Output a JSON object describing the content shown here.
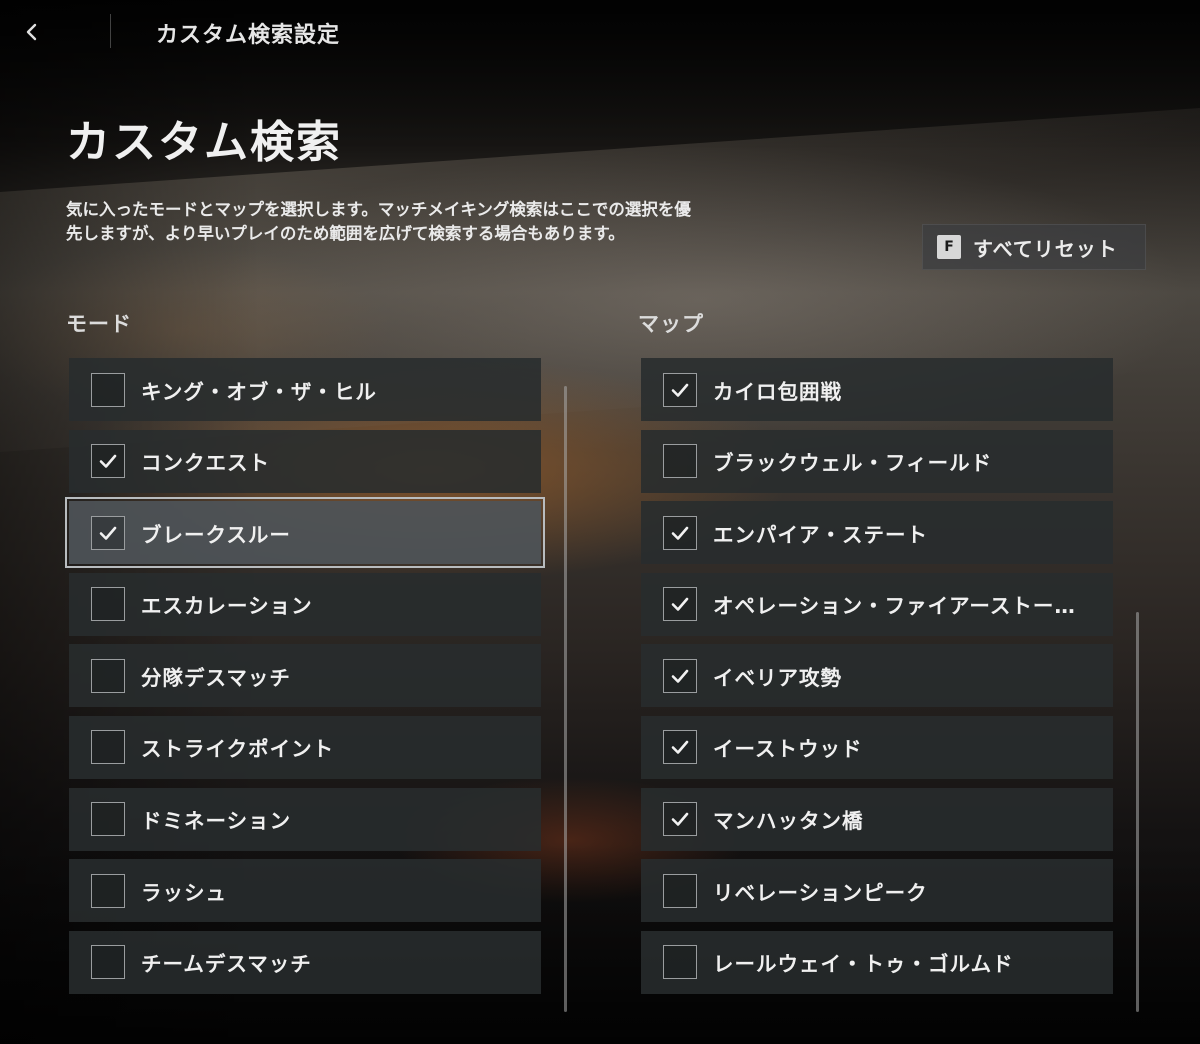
{
  "header": {
    "title": "カスタム検索設定",
    "back_icon": "chevron-left-icon"
  },
  "page": {
    "title": "カスタム検索",
    "description_line1": "気に入ったモードとマップを選択します。マッチメイキング検索はここでの選択を優",
    "description_line2": "先しますが、より早いプレイのため範囲を広げて検索する場合もあります。"
  },
  "reset": {
    "key": "F",
    "label": "すべてリセット"
  },
  "modes": {
    "header": "モード",
    "items": [
      {
        "label": "キング・オブ・ザ・ヒル",
        "checked": false,
        "selected": false
      },
      {
        "label": "コンクエスト",
        "checked": true,
        "selected": false
      },
      {
        "label": "ブレークスルー",
        "checked": true,
        "selected": true
      },
      {
        "label": "エスカレーション",
        "checked": false,
        "selected": false
      },
      {
        "label": "分隊デスマッチ",
        "checked": false,
        "selected": false
      },
      {
        "label": "ストライクポイント",
        "checked": false,
        "selected": false
      },
      {
        "label": "ドミネーション",
        "checked": false,
        "selected": false
      },
      {
        "label": "ラッシュ",
        "checked": false,
        "selected": false
      },
      {
        "label": "チームデスマッチ",
        "checked": false,
        "selected": false
      }
    ]
  },
  "maps": {
    "header": "マップ",
    "items": [
      {
        "label": "カイロ包囲戦",
        "checked": true,
        "selected": false
      },
      {
        "label": "ブラックウェル・フィールド",
        "checked": false,
        "selected": false
      },
      {
        "label": "エンパイア・ステート",
        "checked": true,
        "selected": false
      },
      {
        "label": "オペレーション・ファイアーストー…",
        "checked": true,
        "selected": false
      },
      {
        "label": "イベリア攻勢",
        "checked": true,
        "selected": false
      },
      {
        "label": "イーストウッド",
        "checked": true,
        "selected": false
      },
      {
        "label": "マンハッタン橋",
        "checked": true,
        "selected": false
      },
      {
        "label": "リベレーションピーク",
        "checked": false,
        "selected": false
      },
      {
        "label": "レールウェイ・トゥ・ゴルムド",
        "checked": false,
        "selected": false
      }
    ]
  },
  "icons": {
    "check": "checkmark-icon"
  },
  "colors": {
    "text": "#f0f0f0",
    "row_bg": "#282c2e",
    "row_selected_bg": "#4e5458",
    "checkbox_border": "#9a9d9f"
  }
}
